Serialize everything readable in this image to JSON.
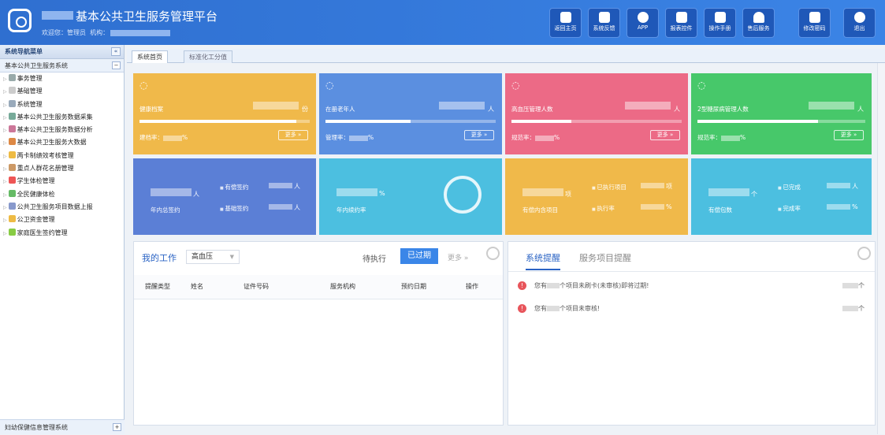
{
  "header": {
    "title": "基本公共卫生服务管理平台",
    "welcome": "欢迎您：管理员",
    "org_label": "机构：",
    "buttons": [
      {
        "label": "返回主页",
        "icon": "home-icon"
      },
      {
        "label": "系统反馈",
        "icon": "feedback-icon"
      },
      {
        "label": "APP",
        "icon": "app-icon"
      },
      {
        "label": "报表控件",
        "icon": "report-icon"
      },
      {
        "label": "操作手册",
        "icon": "manual-icon"
      },
      {
        "label": "售后服务",
        "icon": "service-icon"
      },
      {
        "label": "修改密码",
        "icon": "lock-icon"
      },
      {
        "label": "退出",
        "icon": "exit-icon"
      }
    ]
  },
  "sidebar": {
    "title": "系统导航菜单",
    "collapse": "«",
    "system": "基本公共卫生服务系统",
    "system_toggle": "−",
    "items": [
      {
        "label": "事务管理",
        "icon": "gear-icon"
      },
      {
        "label": "基础管理",
        "icon": "base-icon"
      },
      {
        "label": "系统管理",
        "icon": "system-icon"
      },
      {
        "label": "基本公共卫生服务数据采集",
        "icon": "collect-icon"
      },
      {
        "label": "基本公共卫生服务数据分析",
        "icon": "chart-icon"
      },
      {
        "label": "基本公共卫生服务大数据",
        "icon": "bigdata-icon"
      },
      {
        "label": "两卡制绩效考核管理",
        "icon": "folder-icon"
      },
      {
        "label": "重点人群花名册管理",
        "icon": "people-icon"
      },
      {
        "label": "学生体检管理",
        "icon": "student-icon"
      },
      {
        "label": "全民健康体检",
        "icon": "health-icon"
      },
      {
        "label": "公共卫生服务项目数据上报",
        "icon": "upload-icon"
      },
      {
        "label": "公卫资金管理",
        "icon": "money-icon"
      },
      {
        "label": "家庭医生签约管理",
        "icon": "doctor-icon"
      }
    ],
    "footer": "妇幼保健信息管理系统",
    "footer_toggle": "+"
  },
  "tabs": [
    {
      "label": "系统首页"
    },
    {
      "label": "标准化工分值"
    }
  ],
  "cards": [
    {
      "label": "健康档案",
      "unit": "份",
      "rate": "建档率：",
      "rate_unit": "%",
      "more": "更多 »",
      "color": "#f0b94a",
      "progress": 0.92
    },
    {
      "label": "在册老年人",
      "unit": "人",
      "rate": "管理率：",
      "rate_unit": "%",
      "more": "更多 »",
      "color": "#5b8fe0",
      "progress": 0.5
    },
    {
      "label": "高血压管理人数",
      "unit": "人",
      "rate": "规范率：",
      "rate_unit": "%",
      "more": "更多 »",
      "color": "#ec6a86",
      "progress": 0.35
    },
    {
      "label": "2型糖尿病管理人数",
      "unit": "人",
      "rate": "规范率：",
      "rate_unit": "%",
      "more": "更多 »",
      "color": "#47c86a",
      "progress": 0.72
    }
  ],
  "stats": [
    {
      "unit": "人",
      "sub": "年内总签约",
      "l1": "有偿签约",
      "l1u": "人",
      "l2": "基础签约",
      "l2u": "人",
      "color": "#5b7fd6"
    },
    {
      "unit": "%",
      "sub": "年内续约率",
      "color": "#4cbfe0"
    },
    {
      "unit": "项",
      "sub": "有偿内含项目",
      "l1": "已执行项目",
      "l1u": "项",
      "l2": "执行率",
      "l2u": "%",
      "color": "#f0b94a"
    },
    {
      "unit": "个",
      "sub": "有偿包数",
      "l1": "已完成",
      "l1u": "人",
      "l2": "完成率",
      "l2u": "%",
      "color": "#4cbfe0"
    }
  ],
  "work": {
    "title": "我的工作",
    "select": "高血压",
    "pending": "待执行",
    "expired": "已过期",
    "more": "更多 »",
    "columns": [
      "提醒类型",
      "姓名",
      "证件号码",
      "服务机构",
      "预约日期",
      "操作"
    ]
  },
  "remind": {
    "tab1": "系统提醒",
    "tab2": "服务项目提醒",
    "items": [
      {
        "pre": "您有",
        "text": "个项目未刷卡(未审核)即将过期!",
        "unit": "个"
      },
      {
        "pre": "您有",
        "text": "个项目未审核!",
        "unit": "个"
      }
    ]
  }
}
